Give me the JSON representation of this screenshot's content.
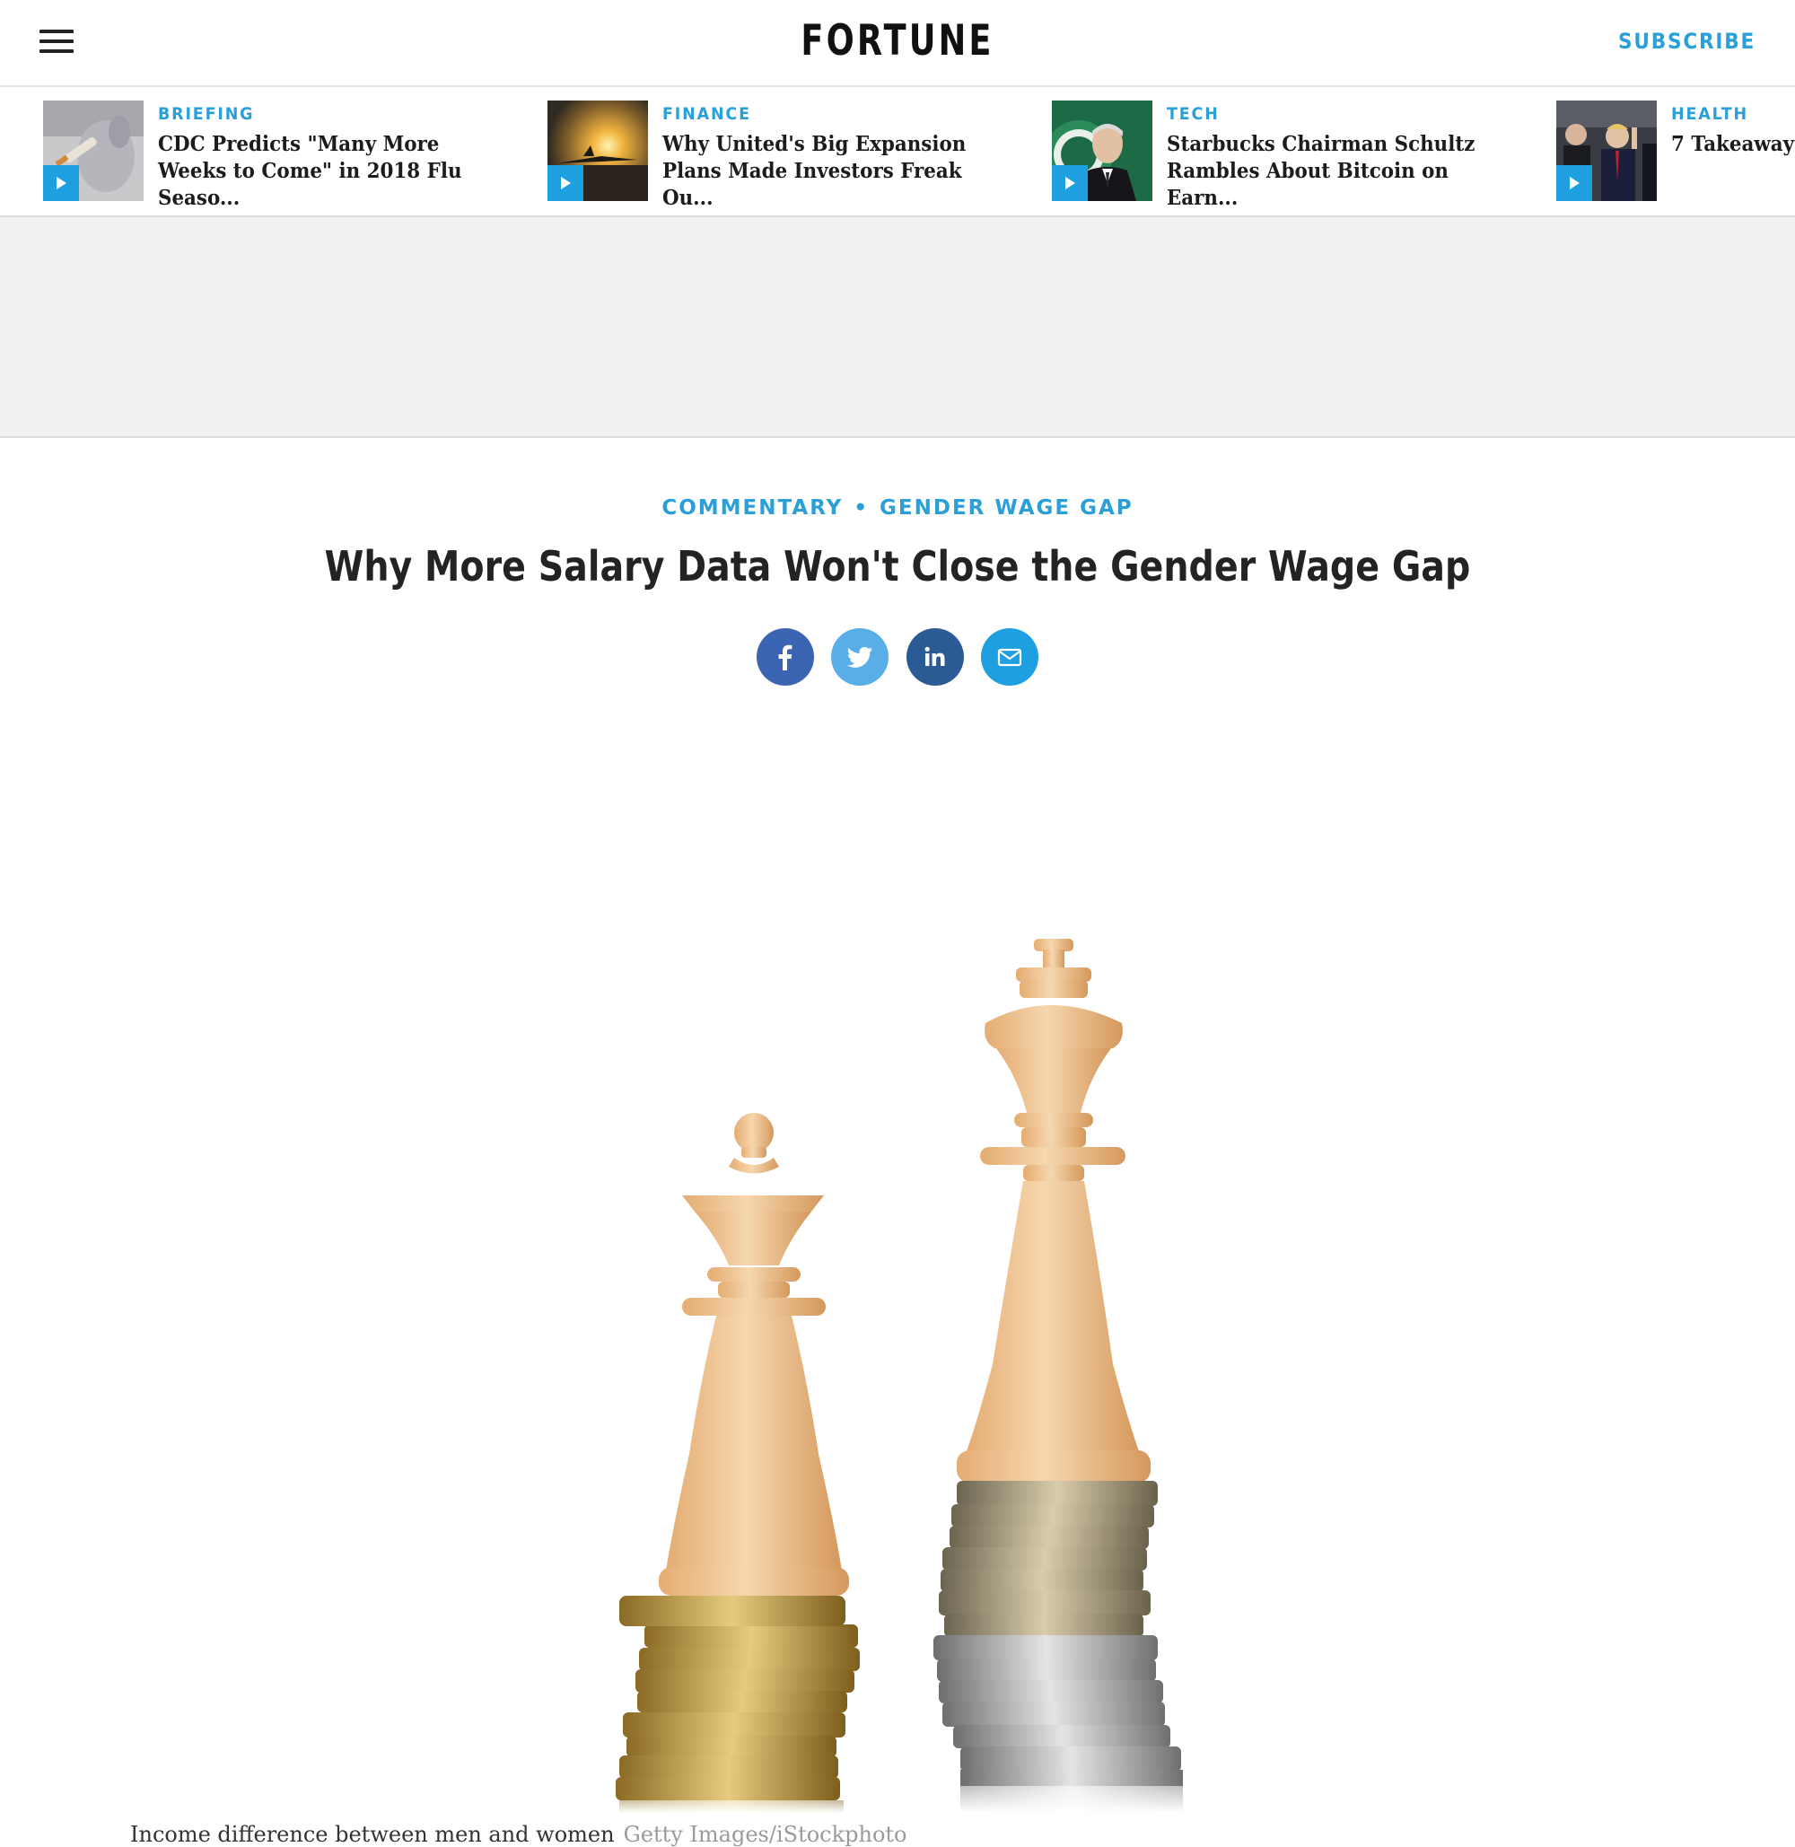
{
  "header": {
    "logo": "FORTUNE",
    "subscribe_label": "SUBSCRIBE"
  },
  "video_strip": [
    {
      "category": "BRIEFING",
      "title": "CDC Predicts \"Many More Weeks to Come\" in 2018 Flu Seaso...",
      "thumb_icon": "flu-vaccine-photo"
    },
    {
      "category": "FINANCE",
      "title": "Why United's Big Expansion Plans Made Investors Freak Ou...",
      "thumb_icon": "airplane-sunset-photo"
    },
    {
      "category": "TECH",
      "title": "Starbucks Chairman Schultz Rambles About Bitcoin on Earn...",
      "thumb_icon": "starbucks-chairman-photo"
    },
    {
      "category": "HEALTH",
      "title": "7 Takeaway",
      "thumb_icon": "crowd-photo"
    }
  ],
  "article": {
    "kicker_primary": "COMMENTARY",
    "kicker_separator": "•",
    "kicker_secondary": "GENDER WAGE GAP",
    "headline": "Why More Salary Data Won't Close the Gender Wage Gap",
    "share": [
      {
        "name": "facebook",
        "icon": "facebook-icon",
        "color": "#3b65b2"
      },
      {
        "name": "twitter",
        "icon": "twitter-icon",
        "color": "#5aaee8"
      },
      {
        "name": "linkedin",
        "icon": "linkedin-icon",
        "color": "#2a5b94"
      },
      {
        "name": "email",
        "icon": "email-icon",
        "color": "#1ea0e0"
      }
    ],
    "hero_image": "chess-queen-king-on-coin-stacks",
    "caption": "Income difference between men and women",
    "caption_credit": "Getty Images/iStockphoto"
  },
  "colors": {
    "accent": "#2b9fd8",
    "ad_background": "#f0f1f2",
    "play_button": "#1ea0e0"
  }
}
